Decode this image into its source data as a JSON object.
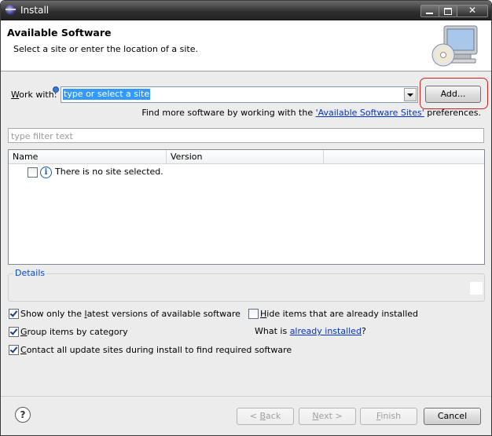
{
  "window": {
    "title": "Install"
  },
  "header": {
    "title": "Available Software",
    "description": "Select a site or enter the location of a site."
  },
  "work_with": {
    "label_mnemonic": "W",
    "label_rest": "ork with:",
    "value": "type or select a site",
    "add_button": "Add..."
  },
  "find_more": {
    "prefix": "Find more software by working with the ",
    "link": "'Available Software Sites'",
    "suffix": " preferences."
  },
  "filter": {
    "placeholder": "type filter text"
  },
  "table": {
    "columns": [
      "Name",
      "Version",
      ""
    ],
    "rows": [
      {
        "text": "There is no site selected.",
        "checked": false
      }
    ]
  },
  "details": {
    "label": "Details"
  },
  "options": {
    "show_latest": {
      "pre": "Show only the ",
      "mn": "l",
      "post": "atest versions of available software",
      "checked": true
    },
    "hide_installed": {
      "pre": "",
      "mn": "H",
      "post": "ide items that are already installed",
      "checked": false
    },
    "group_category": {
      "pre": "",
      "mn": "G",
      "post": "roup items by category",
      "checked": true
    },
    "what_is": {
      "prefix": "What is ",
      "link": "already installed",
      "suffix": "?"
    },
    "contact_sites": {
      "pre": "",
      "mn": "C",
      "post": "ontact all update sites during install to find required software",
      "checked": true
    }
  },
  "buttons": {
    "back": {
      "pre": "< ",
      "mn": "B",
      "post": "ack",
      "enabled": false
    },
    "next": {
      "pre": "",
      "mn": "N",
      "post": "ext >",
      "enabled": false
    },
    "finish": {
      "pre": "",
      "mn": "F",
      "post": "inish",
      "enabled": false
    },
    "cancel": "Cancel"
  },
  "icons": {
    "app": "eclipse-icon",
    "banner": "monitor-cd-icon",
    "info": "info-icon",
    "help": "help-icon"
  },
  "colors": {
    "selection": "#3399ff",
    "link": "#0033cc",
    "highlight_ring": "#d02020",
    "details_label": "#0046d5"
  }
}
